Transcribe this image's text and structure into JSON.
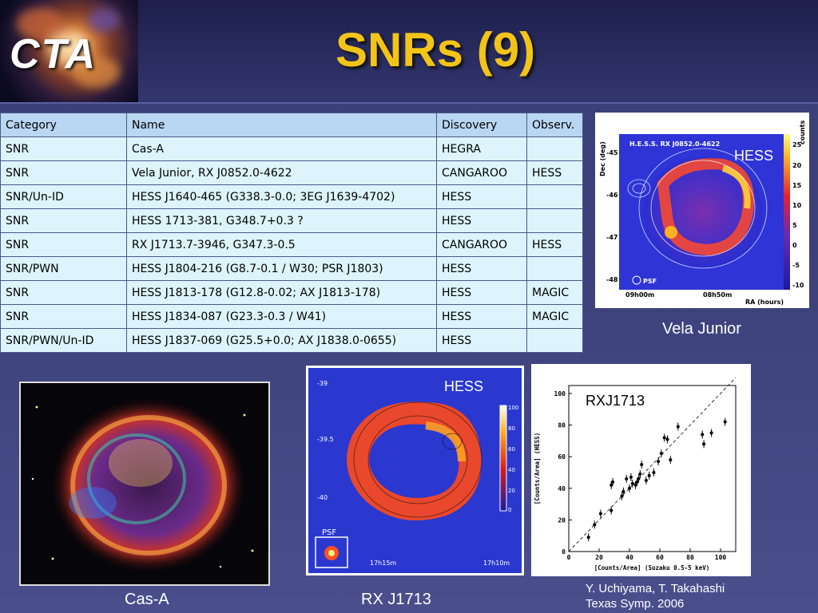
{
  "logo": {
    "text": "CTA"
  },
  "title": "SNRs (9)",
  "table": {
    "headers": [
      "Category",
      "Name",
      "Discovery",
      "Observ."
    ],
    "rows": [
      [
        "SNR",
        "Cas-A",
        "HEGRA",
        ""
      ],
      [
        "SNR",
        "Vela Junior, RX J0852.0-4622",
        "CANGAROO",
        "HESS"
      ],
      [
        "SNR/Un-ID",
        "HESS J1640-465 (G338.3-0.0;  3EG J1639-4702)",
        "HESS",
        ""
      ],
      [
        "SNR",
        "HESS 1713-381, G348.7+0.3 ?",
        "HESS",
        ""
      ],
      [
        "SNR",
        "RX J1713.7-3946,  G347.3-0.5",
        "CANGAROO",
        "HESS"
      ],
      [
        "SNR/PWN",
        "HESS J1804-216 (G8.7-0.1 / W30;  PSR J1803)",
        "HESS",
        ""
      ],
      [
        "SNR",
        "HESS J1813-178 (G12.8-0.02;  AX J1813-178)",
        "HESS",
        "MAGIC"
      ],
      [
        "SNR",
        "HESS J1834-087 (G23.3-0.3 /  W41)",
        "HESS",
        "MAGIC"
      ],
      [
        "SNR/PWN/Un-ID",
        "HESS J1837-069 (G25.5+0.0;  AX J1838.0-0655)",
        "HESS",
        ""
      ]
    ]
  },
  "vela": {
    "caption": "Vela Junior",
    "overlay_label": "HESS",
    "plot_title": "H.E.S.S.    RX J0852.0-4622",
    "y_axis_label": "Dec (deg)",
    "y_ticks": [
      "-45",
      "-46",
      "-47",
      "-48"
    ],
    "x_axis_label": "RA (hours)",
    "x_ticks": [
      "09h00m",
      "08h50m"
    ],
    "colorbar_label": "counts",
    "colorbar_ticks": [
      "25",
      "20",
      "15",
      "10",
      "5",
      "0",
      "-5",
      "-10"
    ],
    "psf_label": "PSF"
  },
  "casa": {
    "caption": "Cas-A"
  },
  "rxj": {
    "caption": "RX J1713",
    "overlay_label": "HESS",
    "y_ticks": [
      "-39",
      "-39.5",
      "-40"
    ],
    "x_ticks": [
      "17h15m",
      "17h10m"
    ],
    "colorbar_ticks": [
      "100",
      "80",
      "60",
      "40",
      "20",
      "0"
    ],
    "psf_label": "PSF"
  },
  "scatter": {
    "label": "RXJ1713",
    "credit_line1": "Y. Uchiyama, T. Takahashi",
    "credit_line2": "Texas Symp. 2006",
    "chart_data": {
      "type": "scatter",
      "xlabel": "[Counts/Area] (Suzaku 0.5-5 keV)",
      "ylabel": "[Counts/Area] (HESS)",
      "xlim": [
        0,
        110
      ],
      "ylim": [
        0,
        105
      ],
      "x_ticks": [
        "0",
        "20",
        "40",
        "60",
        "80",
        "100"
      ],
      "y_ticks": [
        "0",
        "20",
        "40",
        "60",
        "80",
        "100"
      ],
      "points": [
        [
          13,
          9
        ],
        [
          17,
          17
        ],
        [
          21,
          24
        ],
        [
          28,
          26
        ],
        [
          28,
          42
        ],
        [
          29,
          44
        ],
        [
          35,
          35
        ],
        [
          36,
          38
        ],
        [
          38,
          46
        ],
        [
          40,
          40
        ],
        [
          41,
          47
        ],
        [
          42,
          43
        ],
        [
          44,
          42
        ],
        [
          45,
          44
        ],
        [
          46,
          46
        ],
        [
          47,
          49
        ],
        [
          48,
          55
        ],
        [
          51,
          45
        ],
        [
          53,
          48
        ],
        [
          56,
          50
        ],
        [
          59,
          57
        ],
        [
          61,
          62
        ],
        [
          63,
          72
        ],
        [
          65,
          71
        ],
        [
          67,
          58
        ],
        [
          72,
          79
        ],
        [
          88,
          74
        ],
        [
          89,
          68
        ],
        [
          94,
          75
        ],
        [
          103,
          82
        ]
      ],
      "reference_line": "dashed y = x"
    }
  }
}
